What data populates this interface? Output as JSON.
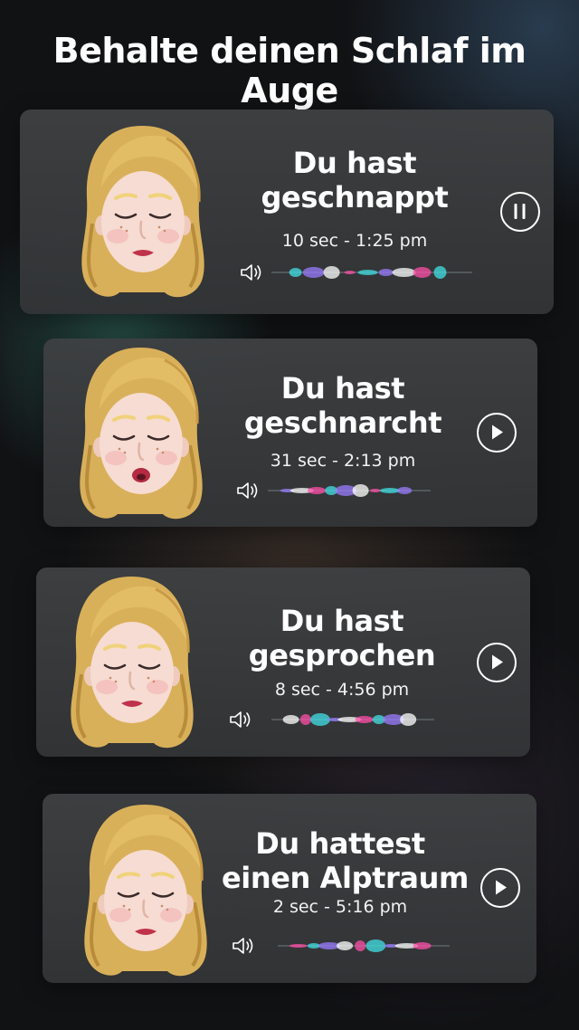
{
  "header": {
    "title": "Behalte deinen Schlaf im Auge"
  },
  "cards": [
    {
      "title_line1": "Du hast",
      "title_line2": "geschnappt",
      "meta": "10 sec - 1:25 pm",
      "state": "playing",
      "avatar": "sleeping-woman-memoji"
    },
    {
      "title_line1": "Du hast",
      "title_line2": "geschnarcht",
      "meta": "31 sec - 2:13 pm",
      "state": "paused",
      "avatar": "snoring-woman-memoji"
    },
    {
      "title_line1": "Du hast",
      "title_line2": "gesprochen",
      "meta": "8 sec - 4:56 pm",
      "state": "paused",
      "avatar": "talking-woman-memoji"
    },
    {
      "title_line1": "Du hattest",
      "title_line2": "einen Alptraum",
      "meta": "2 sec - 5:16 pm",
      "state": "paused",
      "avatar": "dreaming-woman-memoji"
    }
  ],
  "icons": {
    "speaker": "speaker-icon",
    "pause": "pause-icon",
    "play": "play-icon"
  },
  "colors": {
    "wave_pink": "#ff4fa8",
    "wave_cyan": "#42e0e6",
    "wave_violet": "#9a7cff",
    "wave_white": "#ffffff"
  }
}
